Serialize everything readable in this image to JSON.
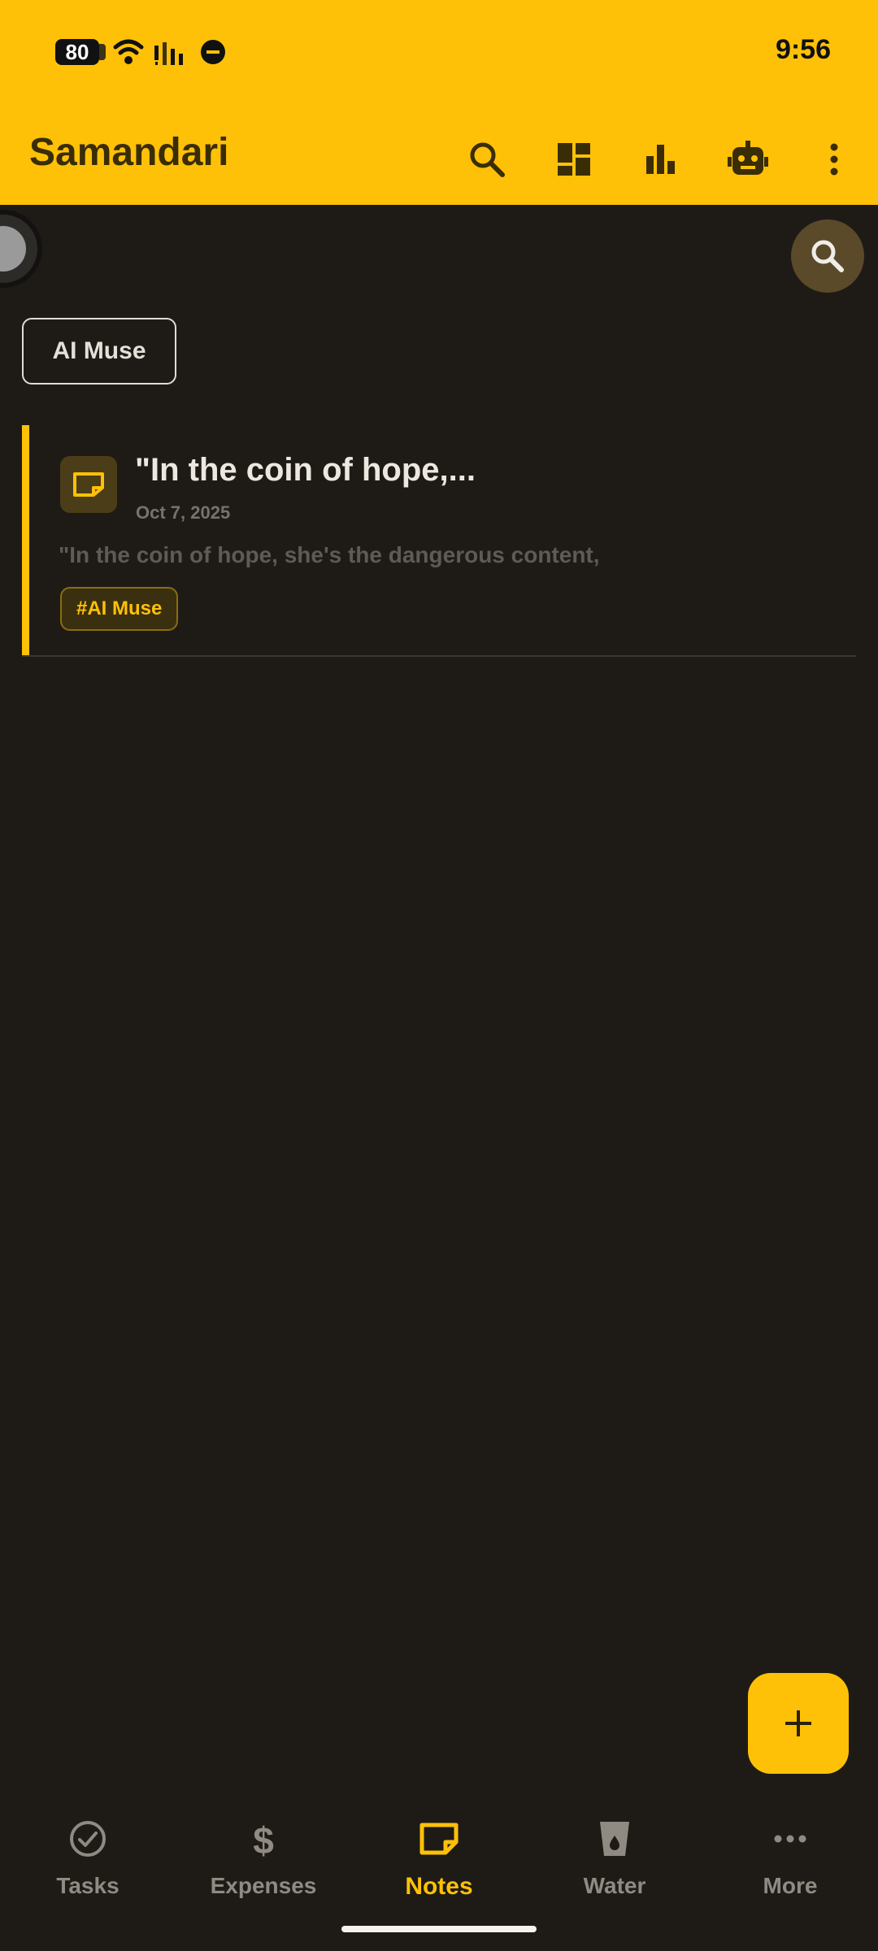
{
  "status_bar": {
    "battery": "80",
    "time": "9:56"
  },
  "app_bar": {
    "title": "Samandari",
    "actions": [
      "search-icon",
      "dashboard-icon",
      "bar-chart-icon",
      "robot-icon",
      "more-vert-icon"
    ]
  },
  "filter_chip": {
    "label": "AI Muse"
  },
  "notes": [
    {
      "title": "\"In the coin of hope,...",
      "date": "Oct 7, 2025",
      "preview": "\"In the coin of hope, she's the dangerous content,",
      "tag": "#AI Muse"
    }
  ],
  "bottom_nav": {
    "items": [
      {
        "label": "Tasks",
        "icon": "check-circle-icon"
      },
      {
        "label": "Expenses",
        "icon": "dollar-icon"
      },
      {
        "label": "Notes",
        "icon": "note-icon"
      },
      {
        "label": "Water",
        "icon": "water-glass-icon"
      },
      {
        "label": "More",
        "icon": "more-horiz-icon"
      }
    ],
    "active": "Notes"
  },
  "colors": {
    "accent": "#ffc107",
    "background": "#1e1b17",
    "app_bar_text": "#3a2d06"
  }
}
